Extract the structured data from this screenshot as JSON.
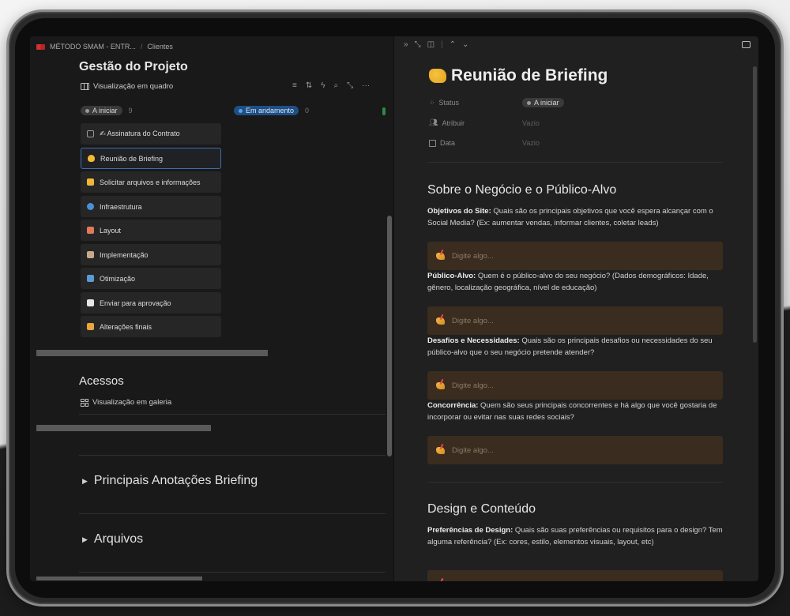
{
  "left": {
    "breadcrumb": {
      "workspace": "MÉTODO SMAM - ENTR...",
      "separator": "/",
      "page": "Clientes"
    },
    "project_title": "Gestão do Projeto",
    "board_view_label": "Visualização em quadro",
    "toolbar_icons": [
      "filter-icon",
      "sort-icon",
      "lightning-icon",
      "search-icon",
      "expand-icon",
      "more-icon"
    ],
    "toolbar_glyphs": {
      "filter": "≡",
      "sort": "⇅",
      "bolt": "ϟ",
      "search": "⌕",
      "expand": "⤡",
      "more": "···"
    },
    "columns": [
      {
        "label": "A iniciar",
        "count": "9"
      },
      {
        "label": "Em andamento",
        "count": "0"
      }
    ],
    "cards": [
      {
        "label": "✍ Assinatura do Contrato",
        "icon": "document-icon",
        "color": "#9a9a9a"
      },
      {
        "label": "Reunião de Briefing",
        "icon": "handshake-icon",
        "color": "#f2b933",
        "selected": true
      },
      {
        "label": "Solicitar arquivos e informações",
        "icon": "folder-icon",
        "color": "#f1b634"
      },
      {
        "label": "Infraestrutura",
        "icon": "globe-icon",
        "color": "#4a90d9"
      },
      {
        "label": "Layout",
        "icon": "palette-icon",
        "color": "#e07a5a"
      },
      {
        "label": "Implementação",
        "icon": "construction-icon",
        "color": "#c8a88a"
      },
      {
        "label": "Otimização",
        "icon": "chart-icon",
        "color": "#5a9ad6"
      },
      {
        "label": "Enviar para aprovação",
        "icon": "robot-icon",
        "color": "#e6e6e6"
      },
      {
        "label": "Alterações finais",
        "icon": "writing-hand-icon",
        "color": "#e9a63a"
      }
    ],
    "access_title": "Acessos",
    "gallery_view_label": "Visualização em galeria",
    "toggle_sections": [
      {
        "label": "Principais Anotações Briefing"
      },
      {
        "label": "Arquivos"
      }
    ]
  },
  "right": {
    "nav_glyphs": {
      "forward": "»",
      "expand": "⤡",
      "split": "◫",
      "up": "⌃",
      "down": "⌄"
    },
    "title": "Reunião de Briefing",
    "properties": [
      {
        "label": "Status",
        "icon": "status-icon",
        "value": "A iniciar",
        "type": "pill"
      },
      {
        "label": "Atribuir",
        "icon": "people-icon",
        "value": "Vazio",
        "type": "empty"
      },
      {
        "label": "Data",
        "icon": "calendar-icon",
        "value": "Vazio",
        "type": "empty"
      }
    ],
    "sections": [
      {
        "heading": "Sobre o Negócio e o Público-Alvo",
        "questions": [
          {
            "bold": "Objetivos do Site:",
            "text": " Quais são os principais objetivos que você espera alcançar com o Social Media? (Ex: aumentar vendas, informar clientes, coletar leads)",
            "placeholder": "Digite algo..."
          },
          {
            "bold": "Público-Alvo:",
            "text": " Quem é o público-alvo do seu negócio? (Dados demográficos: Idade, gênero, localização geográfica, nível de educação)",
            "placeholder": "Digite algo..."
          },
          {
            "bold": "Desafios e Necessidades:",
            "text": " Quais são os principais desafios ou necessidades do seu público-alvo que o seu negócio pretende atender?",
            "placeholder": "Digite algo..."
          },
          {
            "bold": "Concorrência:",
            "text": " Quem são seus principais concorrentes e há algo que você gostaria de incorporar ou evitar nas suas redes sociais?",
            "placeholder": "Digite algo..."
          }
        ]
      },
      {
        "heading": "Design e Conteúdo",
        "questions": [
          {
            "bold": "Preferências de Design:",
            "text": " Quais são suas preferências ou requisitos para o design? Tem alguma referência? (Ex: cores, estilo, elementos visuais, layout, etc)",
            "placeholder": "Digite algo..."
          }
        ]
      }
    ]
  }
}
